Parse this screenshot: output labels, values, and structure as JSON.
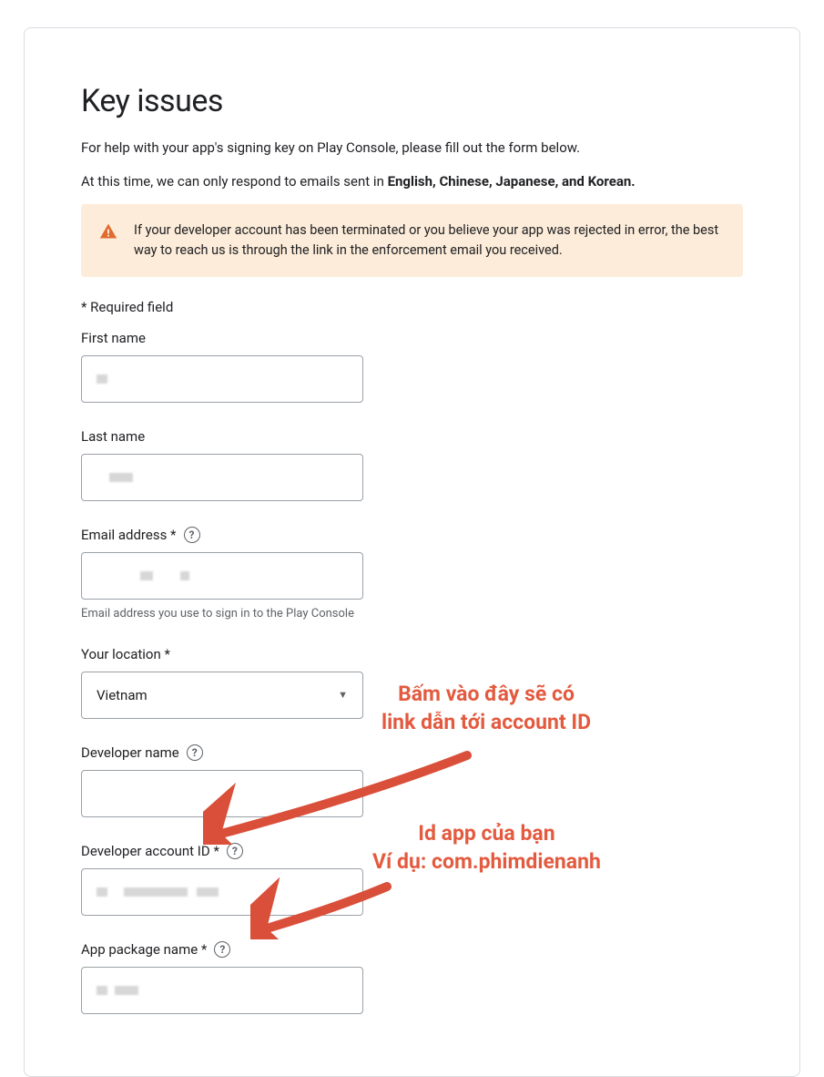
{
  "title": "Key issues",
  "intro": "For help with your app's signing key on Play Console, please fill out the form below.",
  "lang_note_prefix": "At this time, we can only respond to emails sent in ",
  "lang_note_bold": "English, Chinese, Japanese, and Korean.",
  "alert": "If your developer account has been terminated or you believe your app was rejected in error, the best way to reach us is through the link in the enforcement email you received.",
  "required_note": "* Required field",
  "fields": {
    "first_name": {
      "label": "First name"
    },
    "last_name": {
      "label": "Last name"
    },
    "email": {
      "label": "Email address *",
      "helper": "Email address you use to sign in to the Play Console"
    },
    "location": {
      "label": "Your location *",
      "value": "Vietnam"
    },
    "dev_name": {
      "label": "Developer name"
    },
    "dev_account_id": {
      "label": "Developer account ID *"
    },
    "package": {
      "label": "App package name *"
    }
  },
  "annotations": {
    "a1_l1": "Bấm vào đây sẽ có",
    "a1_l2": "link dẫn tới account ID",
    "a2_l1": "Id app của bạn",
    "a2_l2": "Ví dụ: com.phimdienanh"
  }
}
